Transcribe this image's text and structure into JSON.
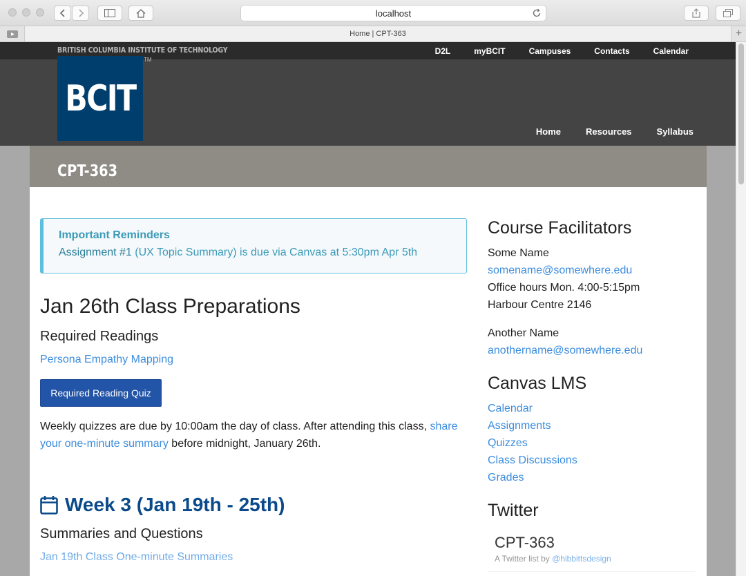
{
  "browser": {
    "address": "localhost",
    "tab_title": "Home | CPT-363"
  },
  "site": {
    "institution": "BRITISH COLUMBIA INSTITUTE OF TECHNOLOGY",
    "top_links": [
      "D2L",
      "myBCIT",
      "Campuses",
      "Contacts",
      "Calendar"
    ],
    "logo_text": "BCIT",
    "logo_tm": "TM",
    "nav": [
      "Home",
      "Resources",
      "Syllabus"
    ],
    "course_code": "CPT-363",
    "brand_color": "#003e6d"
  },
  "alert": {
    "title": "Important Reminders",
    "prefix": "Assignment #1 ",
    "link_text": "(UX Topic Summary) is due via Canvas at 5:30pm Apr 5th"
  },
  "prep": {
    "heading": "Jan 26th Class Preparations",
    "readings_heading": "Required Readings",
    "reading_link": "Persona Empathy Mapping",
    "quiz_button": "Required Reading Quiz",
    "para_text_1": "Weekly quizzes are due by 10:00am the day of class. After attending this class, ",
    "para_link": "share your one-minute summary",
    "para_text_2": " before midnight, January 26th."
  },
  "week": {
    "icon": "calendar-icon",
    "title": "Week 3 (Jan 19th - 25th)",
    "summaries_heading": "Summaries and Questions",
    "summaries_link": "Jan 19th Class One-minute Summaries"
  },
  "aside": {
    "facilitators_heading": "Course Facilitators",
    "facilitator1": {
      "name": "Some Name",
      "email": "somename@somewhere.edu",
      "hours": "Office hours Mon. 4:00-5:15pm",
      "location": "Harbour Centre 2146"
    },
    "facilitator2": {
      "name": "Another Name",
      "email": "anothername@somewhere.edu"
    },
    "canvas_heading": "Canvas LMS",
    "canvas_links": [
      "Calendar",
      "Assignments",
      "Quizzes",
      "Class Discussions",
      "Grades"
    ],
    "twitter_heading": "Twitter",
    "twitter_list_title": "CPT-363",
    "twitter_by": "A Twitter list by ",
    "twitter_handle": "@hibbittsdesign"
  }
}
